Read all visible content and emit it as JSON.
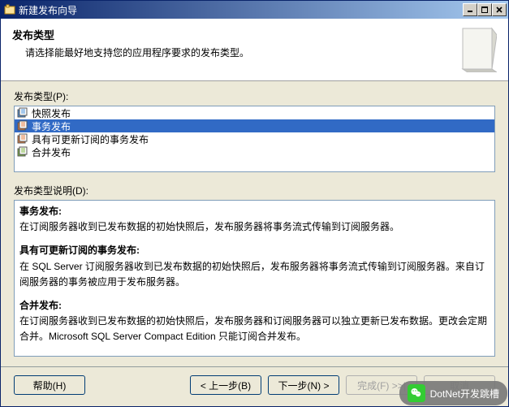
{
  "window": {
    "title": "新建发布向导"
  },
  "header": {
    "title": "发布类型",
    "subtitle": "请选择能最好地支持您的应用程序要求的发布类型。"
  },
  "list": {
    "label": "发布类型(P):",
    "items": [
      {
        "label": "快照发布",
        "selected": false
      },
      {
        "label": "事务发布",
        "selected": true
      },
      {
        "label": "具有可更新订阅的事务发布",
        "selected": false
      },
      {
        "label": "合并发布",
        "selected": false
      }
    ]
  },
  "desc": {
    "label": "发布类型说明(D):",
    "blocks": [
      {
        "title": "事务发布:",
        "body": "在订阅服务器收到已发布数据的初始快照后，发布服务器将事务流式传输到订阅服务器。"
      },
      {
        "title": "具有可更新订阅的事务发布:",
        "body": "在 SQL Server 订阅服务器收到已发布数据的初始快照后，发布服务器将事务流式传输到订阅服务器。来自订阅服务器的事务被应用于发布服务器。"
      },
      {
        "title": "合并发布:",
        "body": "在订阅服务器收到已发布数据的初始快照后，发布服务器和订阅服务器可以独立更新已发布数据。更改会定期合并。Microsoft SQL Server Compact Edition 只能订阅合并发布。"
      }
    ]
  },
  "buttons": {
    "help": "帮助(H)",
    "back": "< 上一步(B)",
    "next": "下一步(N) >",
    "finish": "完成(F) >>|",
    "cancel": "取消"
  },
  "overlay": {
    "text": "DotNet开发跳槽"
  }
}
